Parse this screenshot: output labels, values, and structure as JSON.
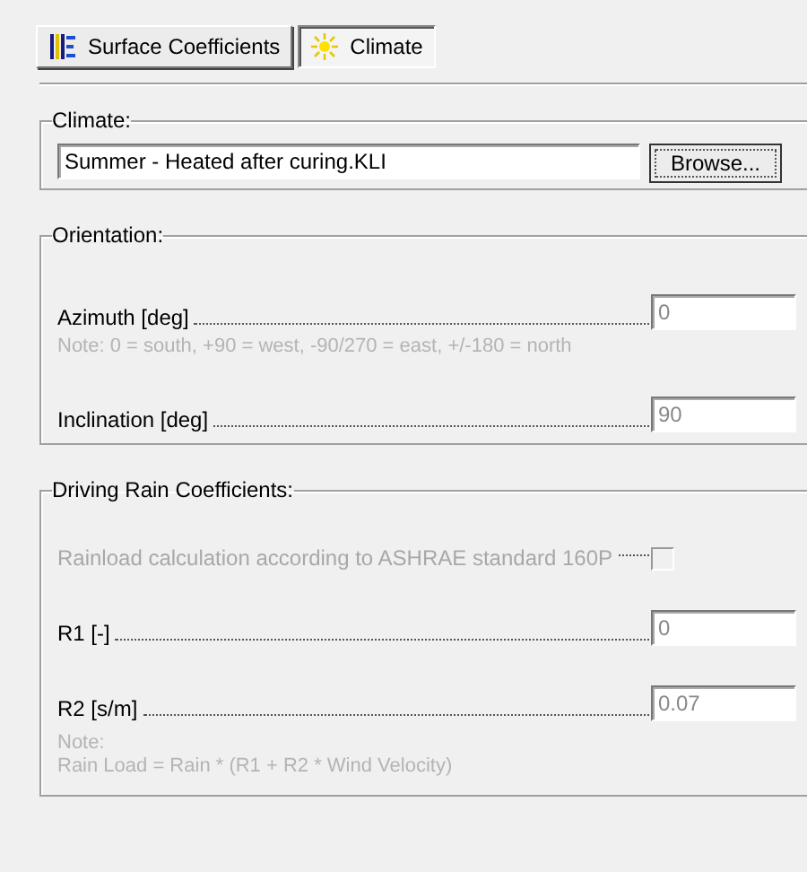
{
  "tabs": [
    {
      "label": "Surface Coefficients",
      "selected": false
    },
    {
      "label": "Climate",
      "selected": true
    }
  ],
  "climate": {
    "title": "Climate:",
    "file": "Summer - Heated after curing.KLI",
    "button": "Browse..."
  },
  "orientation": {
    "title": "Orientation:",
    "rows": [
      {
        "kind": "field",
        "label": "Azimuth [deg]",
        "value": "0",
        "note": "Note: 0 = south, +90 = west, -90/270 = east, +/-180 = north"
      },
      {
        "kind": "field",
        "label": "Inclination [deg]",
        "value": "90"
      }
    ]
  },
  "driving_rain": {
    "title": "Driving Rain Coefficients:",
    "rows": [
      {
        "kind": "checkbox",
        "label": "Rainload calculation according to ASHRAE standard 160P",
        "checked": false,
        "disabled": true
      },
      {
        "kind": "field",
        "label": "R1 [-]",
        "value": "0"
      },
      {
        "kind": "field",
        "label": "R2 [s/m]",
        "value": "0.07"
      }
    ],
    "note": [
      "Note:",
      "Rain Load = Rain * (R1 + R2 * Wind Velocity)"
    ]
  }
}
